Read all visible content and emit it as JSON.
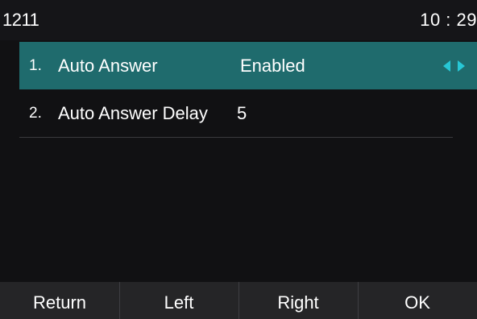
{
  "status_bar": {
    "account": "1211",
    "time": "10 : 29"
  },
  "settings": {
    "items": [
      {
        "index": "1.",
        "label": "Auto Answer",
        "value": "Enabled",
        "selected": true
      },
      {
        "index": "2.",
        "label": "Auto Answer Delay",
        "value": "5",
        "selected": false
      }
    ]
  },
  "icons": {
    "value_left": "chevron-left-icon",
    "value_right": "chevron-right-icon"
  },
  "colors": {
    "highlight": "#1f6b6d",
    "arrow_accent": "#27c7d6",
    "background": "#111113",
    "softkey_background": "#252527"
  },
  "softkeys": [
    "Return",
    "Left",
    "Right",
    "OK"
  ]
}
